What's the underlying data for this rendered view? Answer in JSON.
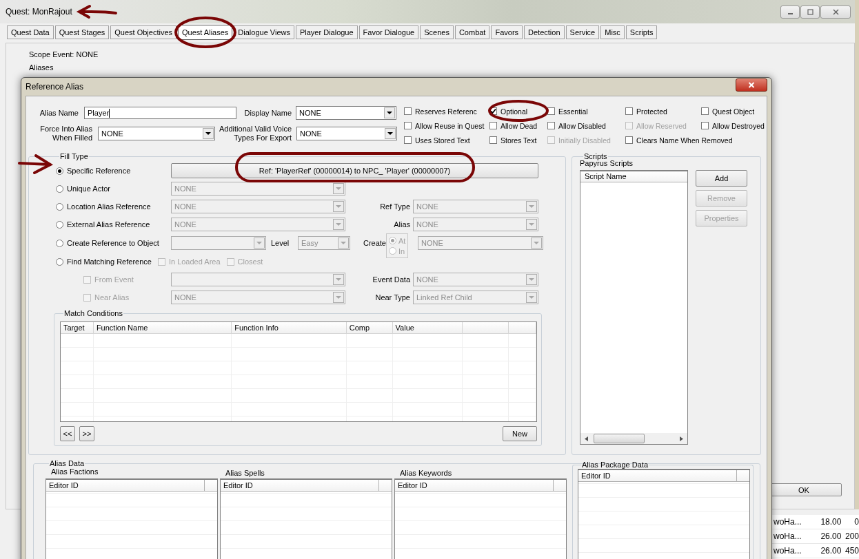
{
  "main_window": {
    "title": "Quest: MonRajout",
    "tabs": [
      {
        "label": "Quest Data",
        "selected": false
      },
      {
        "label": "Quest Stages",
        "selected": false
      },
      {
        "label": "Quest Objectives",
        "selected": false
      },
      {
        "label": "Quest Aliases",
        "selected": true
      },
      {
        "label": "Dialogue Views",
        "selected": false
      },
      {
        "label": "Player Dialogue",
        "selected": false
      },
      {
        "label": "Favor Dialogue",
        "selected": false
      },
      {
        "label": "Scenes",
        "selected": false
      },
      {
        "label": "Combat",
        "selected": false
      },
      {
        "label": "Favors",
        "selected": false
      },
      {
        "label": "Detection",
        "selected": false
      },
      {
        "label": "Service",
        "selected": false
      },
      {
        "label": "Misc",
        "selected": false
      },
      {
        "label": "Scripts",
        "selected": false
      }
    ],
    "scope_event": "Scope Event: NONE",
    "aliases_label": "Aliases",
    "ok_button": "OK"
  },
  "background_table": {
    "rows": [
      [
        "woHa...",
        "18.00",
        "0"
      ],
      [
        "woHa...",
        "26.00",
        "200"
      ],
      [
        "woHa...",
        "26.00",
        "450"
      ]
    ]
  },
  "dialog": {
    "title": "Reference Alias",
    "alias_name": {
      "label": "Alias Name",
      "value": "Player"
    },
    "display_name": {
      "label": "Display Name",
      "value": "NONE",
      "disabled": false
    },
    "force_into_alias": {
      "label": "Force Into Alias\nWhen Filled",
      "value": "NONE",
      "disabled": false
    },
    "voice_types": {
      "label": "Additional Valid Voice\nTypes For Export",
      "value": "NONE",
      "disabled": false
    },
    "flags": [
      {
        "label": "Reserves Referenc",
        "checked": false,
        "disabled": false
      },
      {
        "label": "Optional",
        "checked": true,
        "disabled": false
      },
      {
        "label": "Essential",
        "checked": false,
        "disabled": false
      },
      {
        "label": "Protected",
        "checked": false,
        "disabled": false
      },
      {
        "label": "Quest Object",
        "checked": false,
        "disabled": false
      },
      {
        "label": "Allow Reuse in Quest",
        "checked": false,
        "disabled": false
      },
      {
        "label": "Allow Dead",
        "checked": false,
        "disabled": false
      },
      {
        "label": "Allow Disabled",
        "checked": false,
        "disabled": false
      },
      {
        "label": "Allow Reserved",
        "checked": false,
        "disabled": true
      },
      {
        "label": "Allow Destroyed",
        "checked": false,
        "disabled": false
      },
      {
        "label": "Uses Stored Text",
        "checked": false,
        "disabled": false
      },
      {
        "label": "Stores Text",
        "checked": false,
        "disabled": false
      },
      {
        "label": "Initially Disabled",
        "checked": false,
        "disabled": true
      },
      {
        "label": "Clears Name When Removed",
        "checked": false,
        "disabled": false
      }
    ],
    "fill_type": {
      "legend": "Fill Type",
      "options": [
        {
          "kind": "button",
          "label": "Specific Reference",
          "selected": true,
          "button": "Ref: 'PlayerRef' (00000014) to NPC_ 'Player' (00000007)"
        },
        {
          "kind": "combo",
          "label": "Unique Actor",
          "selected": false,
          "combo": {
            "value": "NONE",
            "disabled": true
          }
        },
        {
          "kind": "combo",
          "label": "Location Alias Reference",
          "selected": false,
          "combo": {
            "value": "NONE",
            "disabled": true
          },
          "side": {
            "label": "Ref Type",
            "value": "NONE",
            "disabled": true
          }
        },
        {
          "kind": "combo",
          "label": "External Alias Reference",
          "selected": false,
          "combo": {
            "value": "NONE",
            "disabled": true
          },
          "side": {
            "label": "Alias",
            "value": "NONE",
            "disabled": true
          }
        },
        {
          "kind": "create",
          "label": "Create Reference to Object",
          "selected": false,
          "combo": {
            "disabled": true
          },
          "level": {
            "label": "Level",
            "value": "Easy",
            "disabled": true
          },
          "create": {
            "label": "Create",
            "disabled": true,
            "radios": [
              {
                "label": "At",
                "selected": true
              },
              {
                "label": "In",
                "selected": false
              }
            ]
          },
          "side": {
            "value": "NONE",
            "disabled": true
          }
        },
        {
          "kind": "find",
          "label": "Find Matching Reference",
          "selected": false,
          "checks": [
            {
              "label": "In Loaded Area",
              "checked": false,
              "disabled": true
            },
            {
              "label": "Closest",
              "checked": false,
              "disabled": true
            }
          ]
        }
      ],
      "sub_options": [
        {
          "label": "From Event",
          "checked": false,
          "disabled": true,
          "combo": {
            "disabled": true
          },
          "side": {
            "label": "Event Data",
            "value": "NONE",
            "disabled": true
          }
        },
        {
          "label": "Near Alias",
          "checked": false,
          "disabled": true,
          "combo": {
            "value": "NONE",
            "disabled": true
          },
          "side": {
            "label": "Near Type",
            "value": "Linked Ref Child",
            "disabled": true
          }
        }
      ],
      "match_conditions": {
        "legend": "Match Conditions",
        "columns": [
          "Target",
          "Function Name",
          "Function Info",
          "Comp",
          "Value"
        ],
        "prev_button": "<<",
        "next_button": ">>",
        "new_button": "New"
      }
    },
    "scripts": {
      "legend": "Scripts",
      "label": "Papyrus Scripts",
      "column": "Script Name",
      "buttons": [
        {
          "label": "Add",
          "disabled": false
        },
        {
          "label": "Remove",
          "disabled": true
        },
        {
          "label": "Properties",
          "disabled": true
        }
      ]
    },
    "alias_data": {
      "legend": "Alias Data",
      "lists": [
        {
          "kind": "plain",
          "title": "Alias Factions",
          "column": "Editor ID"
        },
        {
          "kind": "plain",
          "title": "Alias Spells",
          "column": "Editor ID"
        },
        {
          "kind": "plain",
          "title": "Alias Keywords",
          "column": "Editor ID"
        },
        {
          "kind": "group",
          "title": "Alias Package Data",
          "column": "Editor ID"
        }
      ]
    }
  }
}
